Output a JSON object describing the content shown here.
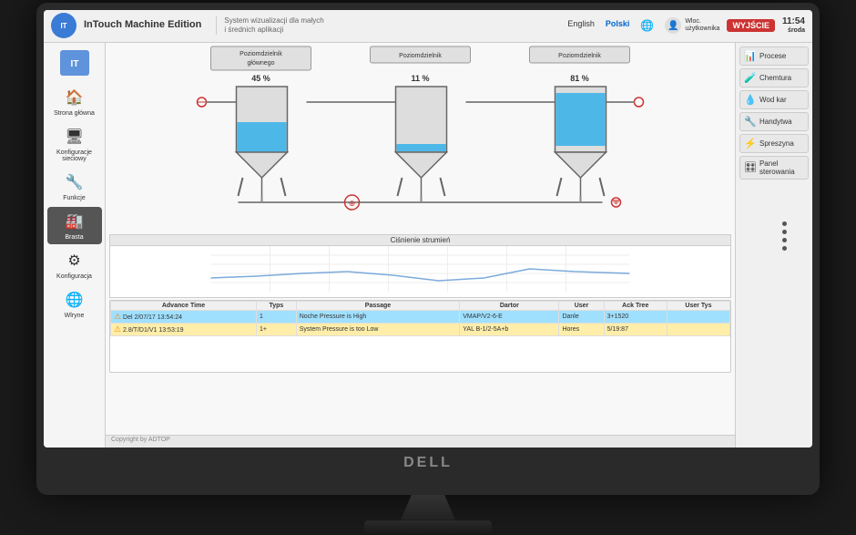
{
  "topbar": {
    "logo_text": "IT",
    "title": "InTouch Machine Edition",
    "subtitle": "System wizualizacji dla małych\ni średnich aplikacji",
    "lang_en": "English",
    "lang_pl": "Polski",
    "user_label": "Wloc.\nużytkownika",
    "logout_label": "WYJŚCIE",
    "time": "11:54",
    "date": "środa"
  },
  "sidebar": {
    "items": [
      {
        "label": "Strona główna",
        "icon": "🏠",
        "active": false
      },
      {
        "label": "Konfiguracje sieciowy",
        "icon": "🖥",
        "active": false
      },
      {
        "label": "Funkcje",
        "icon": "⚙",
        "active": false
      },
      {
        "label": "Brasta",
        "icon": "🏭",
        "active": true
      },
      {
        "label": "Konfiguracja",
        "icon": "⚙",
        "active": false
      },
      {
        "label": "Wlryne",
        "icon": "🌐",
        "active": false
      }
    ]
  },
  "tanks": [
    {
      "label": "Poziomdzielnik",
      "sublabel": "głównego",
      "percent": "45 %",
      "fill_pct": 45
    },
    {
      "label": "Poziomdzielnik",
      "sublabel": "",
      "percent": "11 %",
      "fill_pct": 11
    },
    {
      "label": "Poziomdzielnik",
      "sublabel": "",
      "percent": "81 %",
      "fill_pct": 81
    }
  ],
  "chart": {
    "title": "Ciśnienie strumień",
    "grid_lines": 5
  },
  "alarms": {
    "columns": [
      "Advance Time",
      "Typs",
      "Passage",
      "Dartor",
      "User",
      "Ack Tree",
      "User Tys"
    ],
    "rows": [
      {
        "type": "warning",
        "time": "Del 2/07/17 13:54:24",
        "typs": "1",
        "passage": "Noche Pressure is High",
        "dartor": "VMAP/V2-6-E",
        "user": "Danle",
        "ack": "3+1520",
        "user_tys": "",
        "style": "active"
      },
      {
        "type": "warning",
        "time": "2.8/T/D1/V1 13:53:19",
        "typs": "1+",
        "passage": "System Pressure is too Low",
        "dartor": "YAL B-1/2-5A+b",
        "user": "Hores",
        "ack": "5/19:87",
        "user_tys": "",
        "style": "ack"
      }
    ]
  },
  "right_sidebar": {
    "items": [
      {
        "label": "Procese",
        "icon": "📊"
      },
      {
        "label": "Chemtura",
        "icon": "🧪"
      },
      {
        "label": "Wod kar",
        "icon": "💧"
      },
      {
        "label": "Handytwa",
        "icon": "🔧"
      },
      {
        "label": "Spreszyna",
        "icon": "⚡"
      },
      {
        "label": "Panel sterowania",
        "icon": "🎛"
      }
    ]
  },
  "copyright": "Copyright by ADTOP"
}
